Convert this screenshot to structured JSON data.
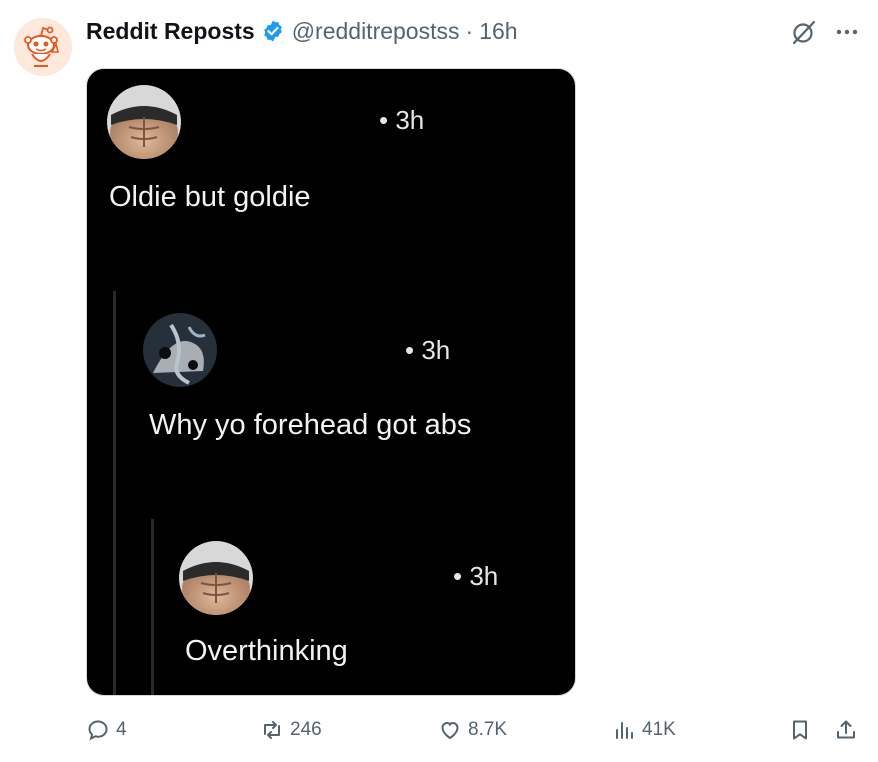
{
  "post": {
    "author_name": "Reddit Reposts",
    "handle": "@redditrepostss",
    "separator": "·",
    "time": "16h"
  },
  "media": {
    "comments": [
      {
        "time": "• 3h",
        "text": "Oldie but goldie"
      },
      {
        "time": "• 3h",
        "text": "Why yo forehead got abs"
      },
      {
        "time": "• 3h",
        "text": "Overthinking"
      }
    ]
  },
  "actions": {
    "replies": "4",
    "reposts": "246",
    "likes": "8.7K",
    "views": "41K"
  },
  "colors": {
    "text_primary": "#0f1419",
    "text_secondary": "#536471",
    "verified_blue": "#1d9bf0",
    "reddit_orange": "#e8571c",
    "media_bg": "#000000"
  },
  "icons": [
    "reddit-avatar",
    "verified-badge-icon",
    "grok-icon",
    "more-icon",
    "reply-icon",
    "repost-icon",
    "like-icon",
    "views-icon",
    "bookmark-icon",
    "share-icon"
  ]
}
